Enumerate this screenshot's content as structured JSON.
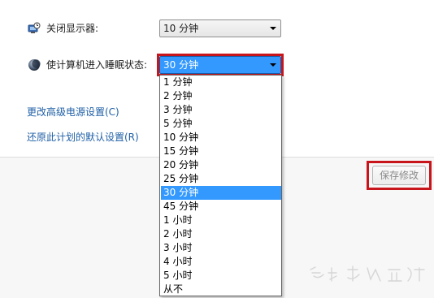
{
  "settings": {
    "display_off": {
      "label": "关闭显示器:",
      "value": "10 分钟",
      "icon": "monitor-clock-icon"
    },
    "sleep": {
      "label": "使计算机进入睡眠状态:",
      "value": "30 分钟",
      "icon": "moon-sleep-icon"
    }
  },
  "links": {
    "advanced": "更改高级电源设置(C)",
    "restore": "还原此计划的默认设置(R)"
  },
  "save_button": "保存修改",
  "dropdown": {
    "options": [
      "1 分钟",
      "2 分钟",
      "3 分钟",
      "5 分钟",
      "10 分钟",
      "15 分钟",
      "20 分钟",
      "25 分钟",
      "30 分钟",
      "45 分钟",
      "1 小时",
      "2 小时",
      "3 小时",
      "4 小时",
      "5 小时",
      "从不"
    ],
    "selected": "30 分钟"
  },
  "colors": {
    "highlight": "#3399ff",
    "annotation_red": "#c8151b",
    "link_blue": "#1f5fa6"
  }
}
